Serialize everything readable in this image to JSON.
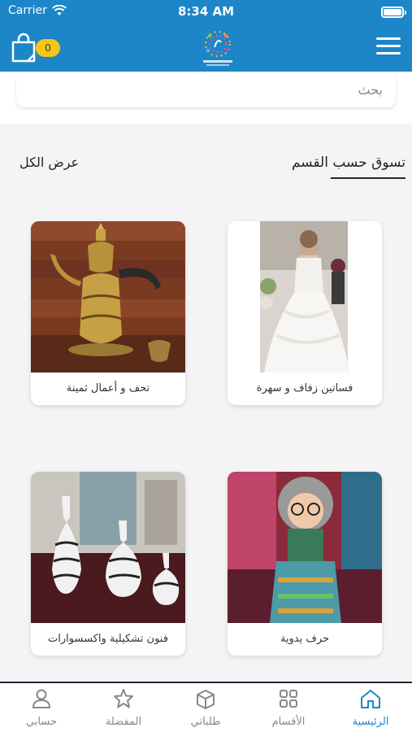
{
  "status": {
    "carrier": "Carrier",
    "time": "8:34 AM"
  },
  "header": {
    "cart_count": "0"
  },
  "search": {
    "placeholder": "بحث"
  },
  "section": {
    "title": "تسوق حسب القسم",
    "view_all": "عرض الكل"
  },
  "categories": [
    {
      "label": "فساتين زفاف و سهرة"
    },
    {
      "label": "تحف و أعمال ثمينة"
    },
    {
      "label": "حرف يدوية"
    },
    {
      "label": "فنون تشكيلية واكسسوارات"
    }
  ],
  "tabs": [
    {
      "label": "الرئيسية"
    },
    {
      "label": "الأقسام"
    },
    {
      "label": "طلباتي"
    },
    {
      "label": "المفضلة"
    },
    {
      "label": "حسابي"
    }
  ],
  "colors": {
    "brand": "#1c86c8",
    "badge": "#f5c518",
    "active_tab": "#1c86c8"
  }
}
